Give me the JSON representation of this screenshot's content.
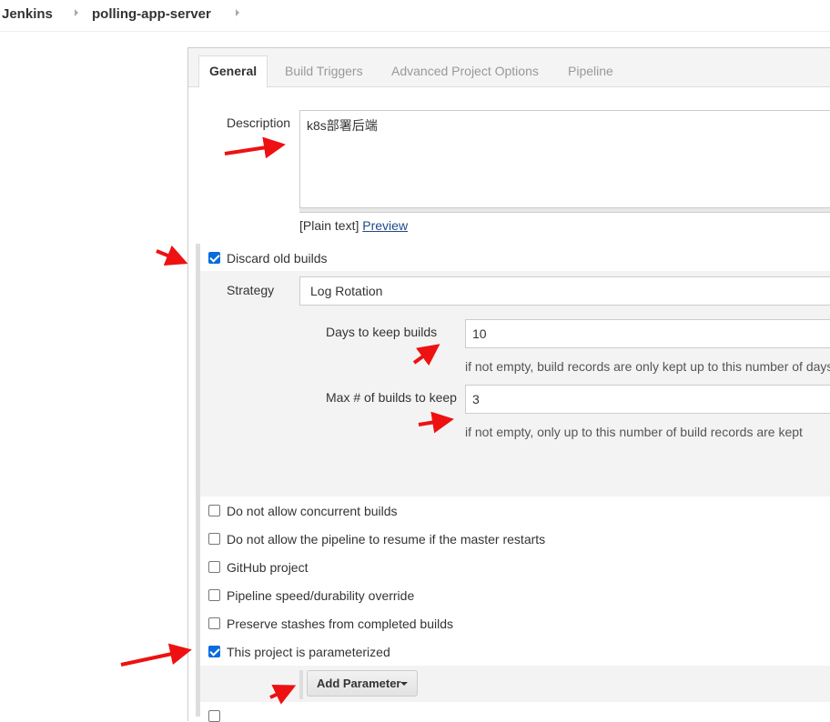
{
  "breadcrumb": {
    "items": [
      "Jenkins",
      "polling-app-server"
    ]
  },
  "tabs": [
    {
      "label": "General",
      "active": true
    },
    {
      "label": "Build Triggers",
      "active": false
    },
    {
      "label": "Advanced Project Options",
      "active": false
    },
    {
      "label": "Pipeline",
      "active": false
    }
  ],
  "description": {
    "label": "Description",
    "value": "k8s部署后端",
    "format_note": "[Plain text]",
    "preview_link": "Preview"
  },
  "discard_old_builds": {
    "label": "Discard old builds",
    "checked": true,
    "strategy_label": "Strategy",
    "strategy_value": "Log Rotation",
    "days_label": "Days to keep builds",
    "days_value": "10",
    "days_hint": "if not empty, build records are only kept up to this number of days",
    "max_label": "Max # of builds to keep",
    "max_value": "3",
    "max_hint": "if not empty, only up to this number of build records are kept"
  },
  "options": [
    {
      "label": "Do not allow concurrent builds",
      "checked": false
    },
    {
      "label": "Do not allow the pipeline to resume if the master restarts",
      "checked": false
    },
    {
      "label": "GitHub project",
      "checked": false
    },
    {
      "label": "Pipeline speed/durability override",
      "checked": false
    },
    {
      "label": "Preserve stashes from completed builds",
      "checked": false
    },
    {
      "label": "This project is parameterized",
      "checked": true
    }
  ],
  "add_parameter": {
    "label": "Add Parameter"
  },
  "colors": {
    "checkbox_checked": "#0b6bdb",
    "annotation_arrow": "#ee1111",
    "link": "#204a87"
  }
}
